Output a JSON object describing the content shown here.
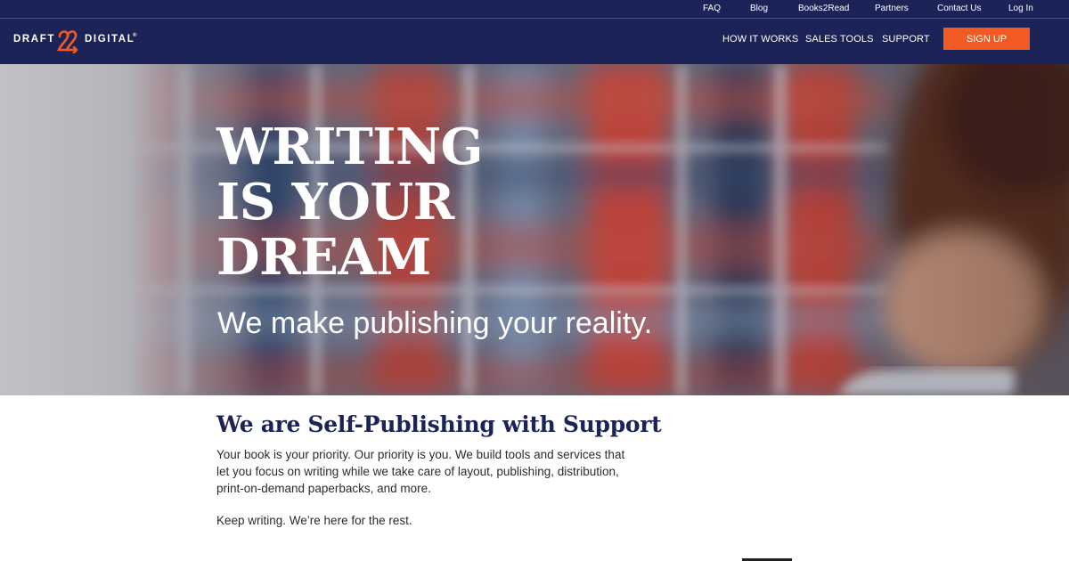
{
  "top_nav": {
    "faq": "FAQ",
    "blog": "Blog",
    "books2read": "Books2Read",
    "partners": "Partners",
    "contact_us": "Contact Us",
    "log_in": "Log In"
  },
  "logo": {
    "left_text": "DRAFT",
    "mark": "2",
    "right_text": "DIGITAL",
    "registered": "®"
  },
  "main_nav": {
    "how_it_works": "HOW IT WORKS",
    "sales_tools": "SALES TOOLS",
    "support": "SUPPORT",
    "sign_up": "SIGN UP"
  },
  "hero": {
    "title_lines": [
      "WRITING",
      "IS YOUR",
      "DREAM"
    ],
    "subtitle": "We make publishing your reality."
  },
  "content": {
    "heading": "We are Self-Publishing with Support",
    "body": "Your book is your priority. Our priority is you. We build tools and services that let you focus on writing while we take care of layout, publishing, distribution, print-on-demand paperbacks, and more.",
    "body2": "Keep writing. We’re here for the rest."
  },
  "colors": {
    "header_bg": "#1c2357",
    "accent": "#f25a24",
    "heading": "#1c2357",
    "text": "#2b2b2b"
  }
}
